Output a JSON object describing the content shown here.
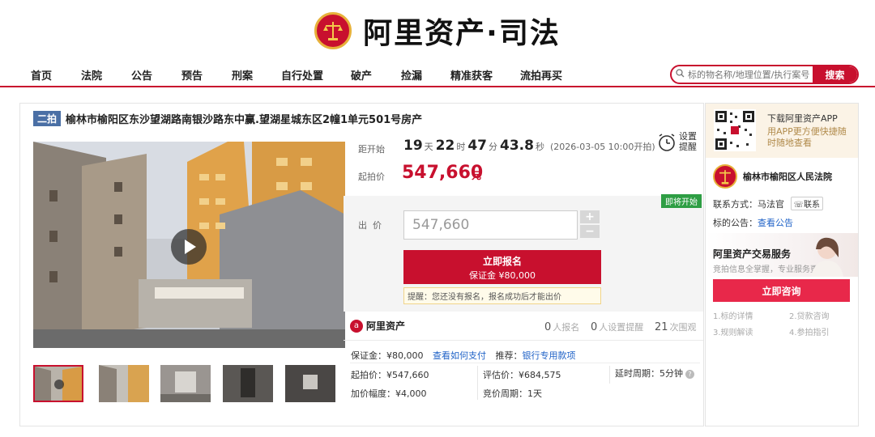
{
  "header": {
    "logo_text": "阿里资产·司法",
    "nav": [
      "首页",
      "法院",
      "公告",
      "预告",
      "刑案",
      "自行处置",
      "破产",
      "捡漏",
      "精准获客",
      "流拍再买"
    ],
    "search_placeholder": "标的物名称/地理位置/执行案号",
    "search_button": "搜索"
  },
  "listing": {
    "round_tag": "二拍",
    "title": "榆林市榆阳区东沙望湖路南银沙路东中赢.望湖星城东区2幢1单元501号房产"
  },
  "countdown": {
    "label": "距开始",
    "days": "19",
    "days_unit": "天",
    "hours": "22",
    "hours_unit": "时",
    "minutes": "47",
    "minutes_unit": "分",
    "seconds": "43.8",
    "seconds_unit": "秒",
    "start_note": "(2026-03-05 10:00开拍)",
    "reminder_label": "设置提醒"
  },
  "price": {
    "start_label": "起拍价",
    "start_value": "547,660",
    "unit": "元"
  },
  "bid": {
    "badge": "即将开始",
    "label": "出  价",
    "value": "547,660",
    "plus": "+",
    "minus": "−",
    "signup_label": "立即报名",
    "deposit_label": "保证金 ¥80,000",
    "reminder_text": "提醒：您还没有报名，报名成功后才能出价"
  },
  "stats": {
    "brand": "阿里资产",
    "signup_count": "0",
    "signup_label": "人报名",
    "remind_count": "0",
    "remind_label": "人设置提醒",
    "view_count": "21",
    "view_label": "次围观"
  },
  "details": {
    "deposit_label": "保证金：",
    "deposit_value": "¥80,000",
    "how_to_pay": "查看如何支付",
    "recommend_label": "推荐：",
    "recommend_link": "银行专用款项",
    "start_price": "起拍价：¥547,660",
    "appraisal": "评估价：¥684,575",
    "delay": "延时周期：5分钟",
    "increment": "加价幅度：¥4,000",
    "auction_period": "竞价周期：1天"
  },
  "sidebar": {
    "app_title": "下载阿里资产APP",
    "app_sub": "用APP更方便快捷随时随地查看",
    "court_name": "榆林市榆阳区人民法院",
    "contact_label": "联系方式：马法官",
    "contact_button": "联系",
    "notice_label": "标的公告：",
    "notice_link": "查看公告",
    "service_title": "阿里资产交易服务",
    "service_sub": "竞拍信息全掌握，专业服务更放心",
    "consult_button": "立即咨询",
    "help_links": [
      "1.标的详情",
      "2.贷款咨询",
      "3.规则解读",
      "4.参拍指引"
    ]
  },
  "colors": {
    "brand_red": "#c8102e",
    "link_blue": "#1f62c7",
    "badge_green": "#2e9e44"
  }
}
